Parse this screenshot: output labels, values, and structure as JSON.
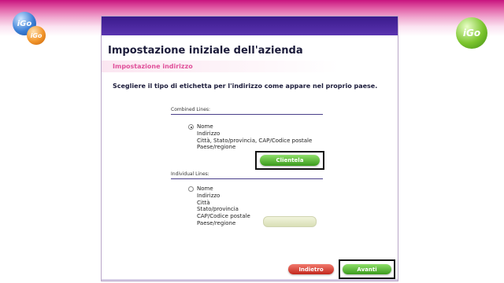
{
  "logos": {
    "left_blue": "iGo",
    "left_orange": "iGo",
    "right_green": "iGo"
  },
  "dialog": {
    "title": "Impostazione iniziale dell'azienda",
    "subtitle": "Impostazione indirizzo",
    "instruction": "Scegliere il tipo di etichetta per l'indirizzo come appare nel proprio paese."
  },
  "combined": {
    "section_label": "Combined Lines:",
    "selected": true,
    "lines": [
      "Nome",
      "Indirizzo",
      "Città, Stato/provincia, CAP/Codice postale",
      "Paese/regione"
    ],
    "button_label": "Clientela"
  },
  "individual": {
    "section_label": "Individual Lines:",
    "selected": false,
    "lines": [
      "Nome",
      "Indirizzo",
      "Città",
      "Stato/provincia",
      "CAP/Codice postale",
      "Paese/regione"
    ]
  },
  "footer": {
    "back_label": "Indietro",
    "next_label": "Avanti"
  },
  "colors": {
    "header_pink": "#c8147e",
    "dialog_titlebar": "#3a1a8c",
    "subtitle_pink": "#e0509a",
    "green_button": "#3a9a1c",
    "red_button": "#c2271c"
  }
}
